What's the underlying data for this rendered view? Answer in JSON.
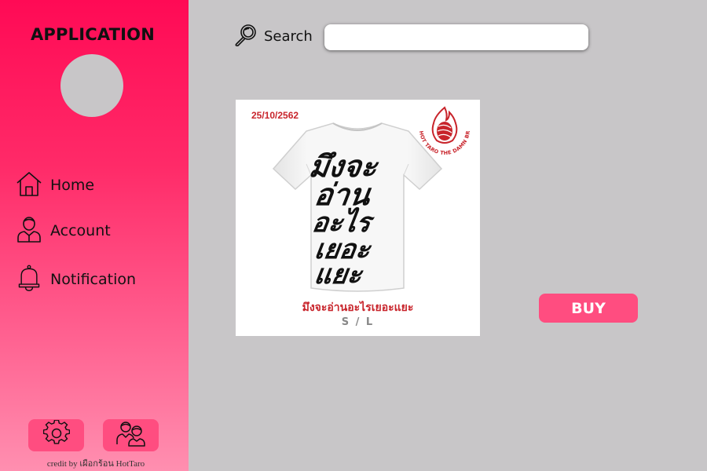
{
  "sidebar": {
    "title": "APPLICATION",
    "nav": {
      "home": {
        "label": "Home",
        "icon": "home-icon"
      },
      "account": {
        "label": "Account",
        "icon": "user-icon"
      },
      "notification": {
        "label": "Notification",
        "icon": "bell-icon"
      }
    },
    "bottom_buttons": [
      "gear-icon",
      "users-icon"
    ],
    "credit": "credit by เผือกร้อน HotTaro"
  },
  "search": {
    "label": "Search",
    "value": "",
    "placeholder": ""
  },
  "product": {
    "date": "25/10/2562",
    "brand_logo_text": "HOT TARO THE DAMN BRAND",
    "shirt_print": "มึงจะอ่านอะไรเยอะแยะ",
    "name": "มึงจะอ่านอะไรเยอะแยะ",
    "sizes": "S / L"
  },
  "buy_button": {
    "label": "BUY"
  },
  "colors": {
    "sidebar_top": "#ff0a55",
    "sidebar_bottom": "#ff8fb0",
    "accent_button": "#ff4d80",
    "background": "#c8c6c8",
    "product_red": "#c8242b"
  }
}
